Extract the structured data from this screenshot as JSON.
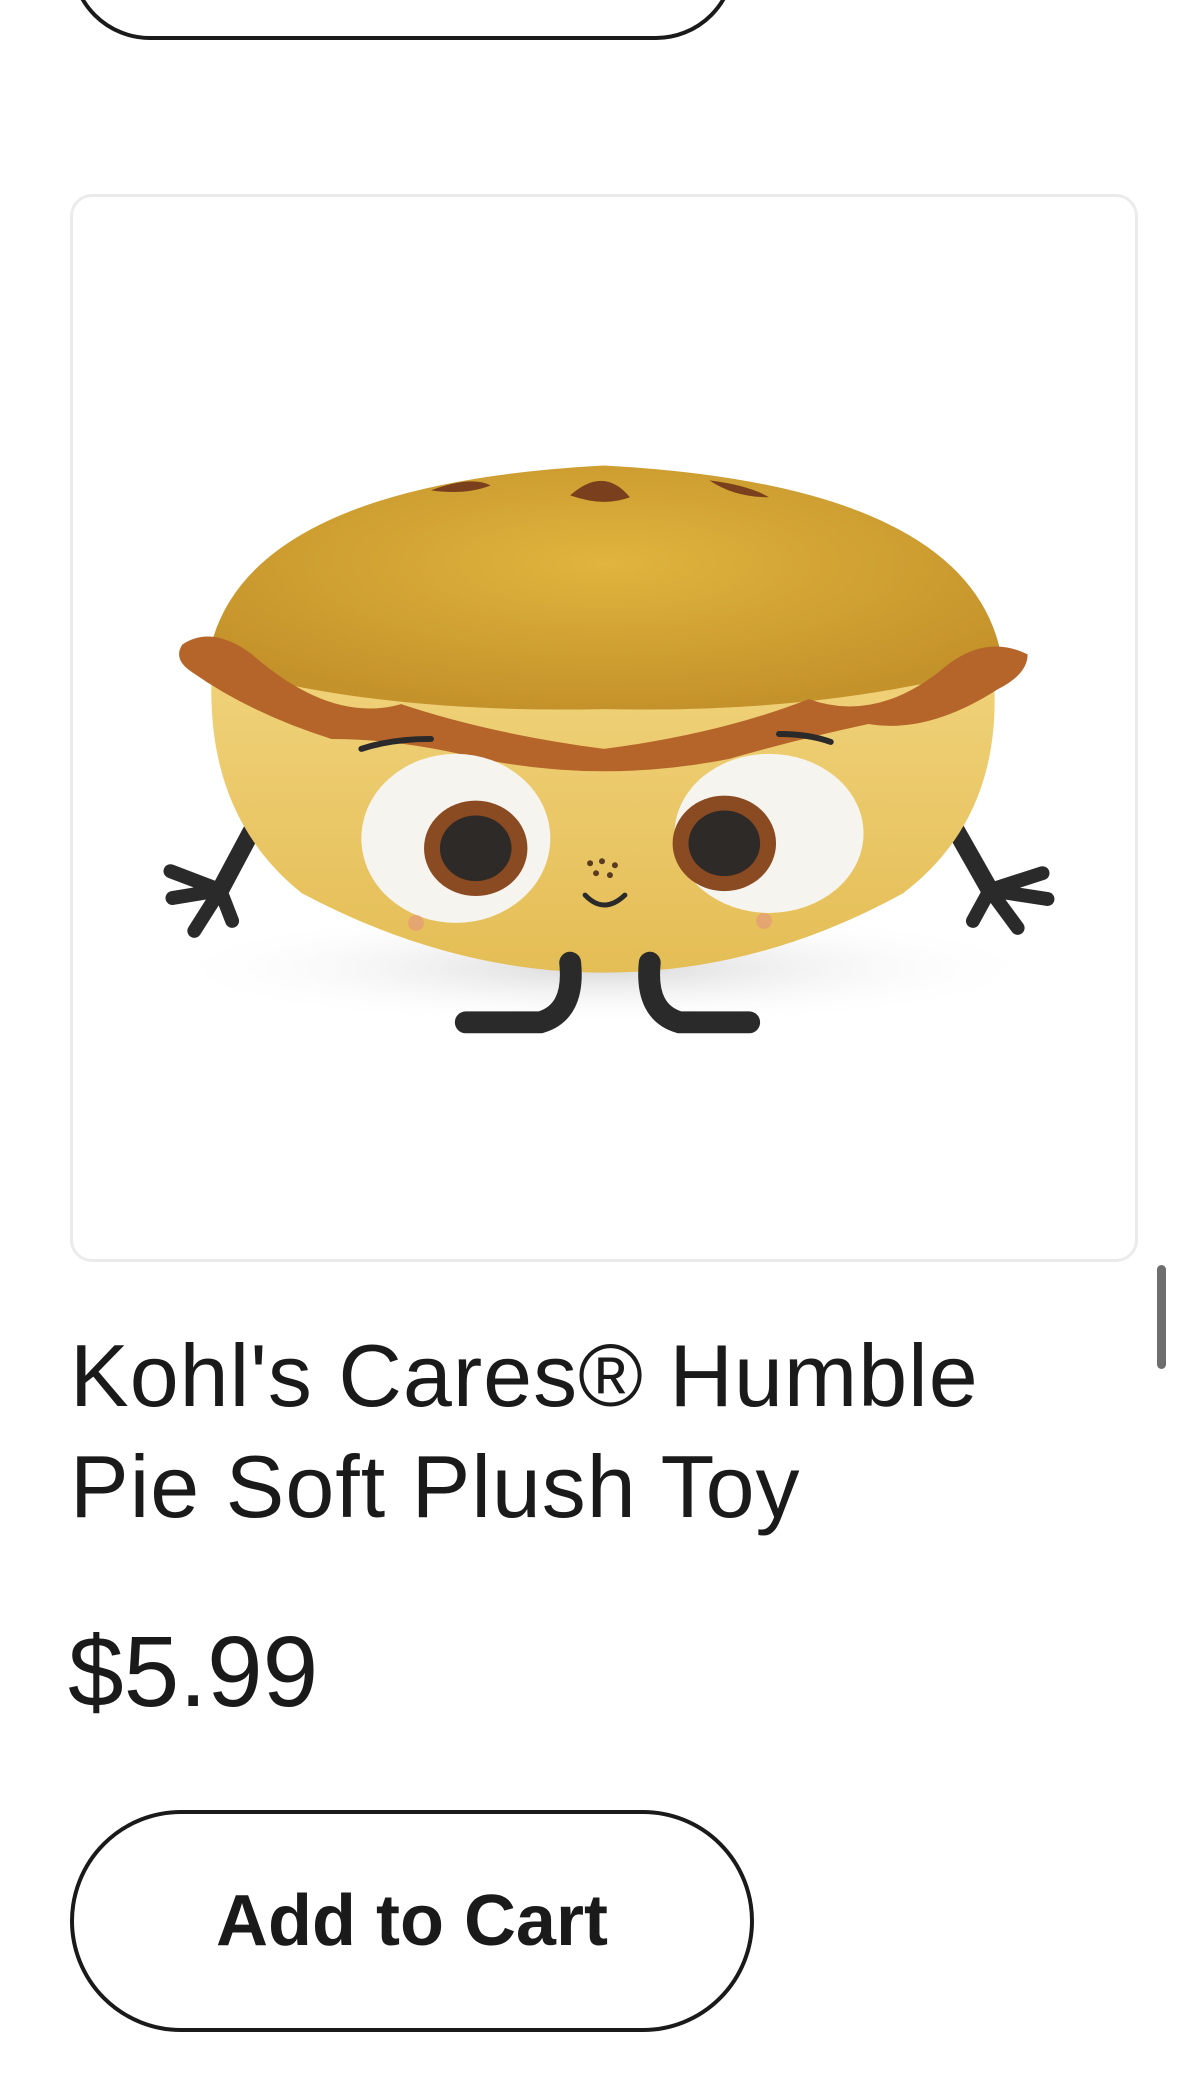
{
  "product": {
    "title": "Kohl's Cares® Humble Pie Soft Plush Toy",
    "price": "$5.99",
    "image_icon": "humble-pie-plush-image"
  },
  "actions": {
    "add_to_cart_label": "Add to Cart"
  },
  "colors": {
    "text": "#1a1a1a",
    "card_border": "#ebebeb",
    "background": "#ffffff",
    "pie_crust": "#d4a93a",
    "pie_rim": "#b5652a"
  }
}
